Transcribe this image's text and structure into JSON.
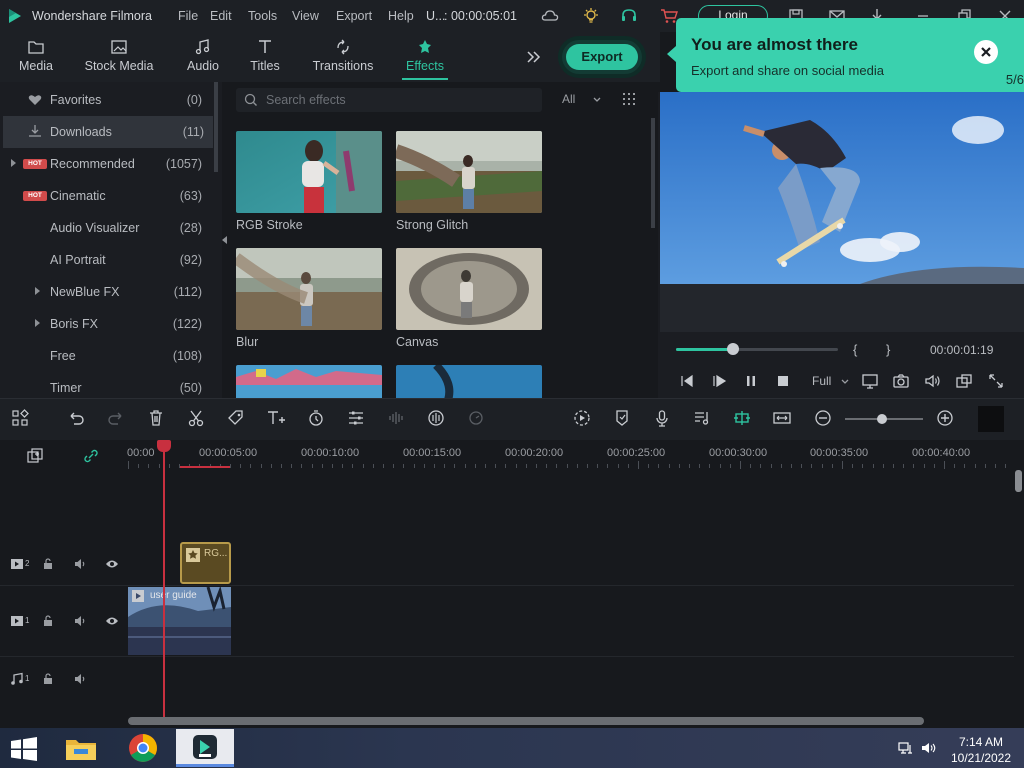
{
  "titlebar": {
    "app_name": "Wondershare Filmora",
    "menus": [
      "File",
      "Edit",
      "Tools",
      "View",
      "Export",
      "Help"
    ],
    "project": "U...",
    "timecode": ": 00:00:05:01",
    "login_label": "Login"
  },
  "toolbar": {
    "tabs": [
      {
        "label": "Media",
        "icon": "folder-icon"
      },
      {
        "label": "Stock Media",
        "icon": "image-icon"
      },
      {
        "label": "Audio",
        "icon": "music-icon"
      },
      {
        "label": "Titles",
        "icon": "text-icon"
      },
      {
        "label": "Transitions",
        "icon": "transition-icon"
      },
      {
        "label": "Effects",
        "icon": "effects-icon",
        "active": true
      }
    ],
    "export_label": "Export"
  },
  "tooltip": {
    "title": "You are almost there",
    "body": "Export and share on social media",
    "page": "5/6"
  },
  "sidebar": {
    "items": [
      {
        "label": "Favorites",
        "count": "(0)"
      },
      {
        "label": "Downloads",
        "count": "(11)",
        "selected": true
      },
      {
        "label": "Recommended",
        "count": "(1057)",
        "hot": true
      },
      {
        "label": "Cinematic",
        "count": "(63)",
        "hot": true
      },
      {
        "label": "Audio Visualizer",
        "count": "(28)"
      },
      {
        "label": "AI Portrait",
        "count": "(92)"
      },
      {
        "label": "NewBlue FX",
        "count": "(112)"
      },
      {
        "label": "Boris FX",
        "count": "(122)"
      },
      {
        "label": "Free",
        "count": "(108)"
      },
      {
        "label": "Timer",
        "count": "(50)"
      }
    ],
    "hot_badge": "HOT"
  },
  "effects_panel": {
    "search_placeholder": "Search effects",
    "filter_value": "All",
    "cards": [
      "RGB Stroke",
      "Strong Glitch",
      "Blur",
      "Canvas"
    ]
  },
  "player": {
    "progress": 0.35,
    "brace_in": "{",
    "brace_out": "}",
    "time": "00:00:01:19",
    "quality": "Full"
  },
  "timeline": {
    "ruler": [
      "00:00",
      "00:00:05:00",
      "00:00:10:00",
      "00:00:15:00",
      "00:00:20:00",
      "00:00:25:00",
      "00:00:30:00",
      "00:00:35:00",
      "00:00:40:00"
    ],
    "tracks": [
      {
        "label": "2",
        "type": "video"
      },
      {
        "label": "1",
        "type": "video"
      },
      {
        "label": "1",
        "type": "audio"
      }
    ],
    "clip_effect": "RG...",
    "clip_video": "user guide"
  },
  "taskbar": {
    "time": "7:14 AM",
    "date": "10/21/2022"
  },
  "colors": {
    "accent": "#2ec4a0",
    "playhead": "#c8303f",
    "tooltip": "#3ad1ae"
  }
}
